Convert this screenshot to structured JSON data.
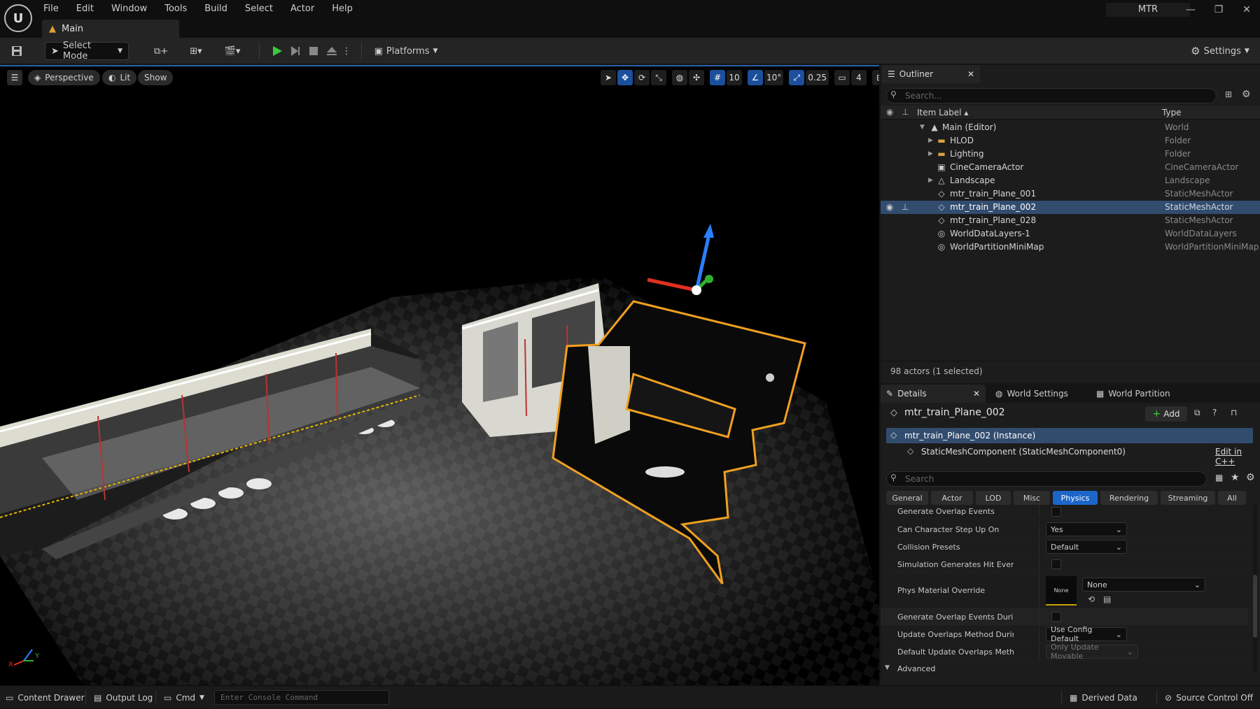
{
  "app": {
    "logo": "U",
    "project": "MTR"
  },
  "menu": [
    "File",
    "Edit",
    "Window",
    "Tools",
    "Build",
    "Select",
    "Actor",
    "Help"
  ],
  "tab": {
    "label": "Main"
  },
  "toolbar": {
    "select_mode": "Select Mode",
    "platforms": "Platforms",
    "settings": "Settings"
  },
  "viewport": {
    "view_mode": "Perspective",
    "lit": "Lit",
    "show": "Show",
    "grid_snap": "10",
    "rot_snap": "10°",
    "scale_snap": "0.25",
    "camera_speed": "4",
    "axis": {
      "x": "X",
      "y": "Y"
    }
  },
  "outliner": {
    "tab": "Outliner",
    "search_placeholder": "Search...",
    "col_label": "Item Label",
    "col_type": "Type",
    "items": [
      {
        "label": "Main (Editor)",
        "type": "World"
      },
      {
        "label": "HLOD",
        "type": "Folder"
      },
      {
        "label": "Lighting",
        "type": "Folder"
      },
      {
        "label": "CineCameraActor",
        "type": "CineCameraActor"
      },
      {
        "label": "Landscape",
        "type": "Landscape"
      },
      {
        "label": "mtr_train_Plane_001",
        "type": "StaticMeshActor"
      },
      {
        "label": "mtr_train_Plane_002",
        "type": "StaticMeshActor"
      },
      {
        "label": "mtr_train_Plane_028",
        "type": "StaticMeshActor"
      },
      {
        "label": "WorldDataLayers-1",
        "type": "WorldDataLayers"
      },
      {
        "label": "WorldPartitionMiniMap",
        "type": "WorldPartitionMiniMap"
      }
    ],
    "footer": "98 actors (1 selected)"
  },
  "details": {
    "tabs": [
      "Details",
      "World Settings",
      "World Partition"
    ],
    "actor_name": "mtr_train_Plane_002",
    "add": "Add",
    "instance": "mtr_train_Plane_002 (Instance)",
    "component": "StaticMeshComponent (StaticMeshComponent0)",
    "edit_cpp": "Edit in C++",
    "search_placeholder": "Search",
    "categories": [
      "General",
      "Actor",
      "LOD",
      "Misc",
      "Physics",
      "Rendering",
      "Streaming",
      "All"
    ],
    "props": {
      "p1": "Generate Overlap Events",
      "p2": "Can Character Step Up On",
      "p2v": "Yes",
      "p3": "Collision Presets",
      "p3v": "Default",
      "p4": "Simulation Generates Hit Events",
      "p5": "Phys Material Override",
      "p5thumb": "None",
      "p5v": "None",
      "p6": "Generate Overlap Events During Level St...",
      "p7": "Update Overlaps Method During Level St...",
      "p7v": "Use Config Default",
      "p8": "Default Update Overlaps Method During...",
      "p8v": "Only Update Movable",
      "advanced": "Advanced"
    }
  },
  "statusbar": {
    "content_drawer": "Content Drawer",
    "output_log": "Output Log",
    "cmd": "Cmd",
    "console_placeholder": "Enter Console Command",
    "derived_data": "Derived Data",
    "source_control": "Source Control Off"
  },
  "colors": {
    "accent": "#1d66c9",
    "selection": "#324c6e",
    "highlight": "#f0a020"
  }
}
